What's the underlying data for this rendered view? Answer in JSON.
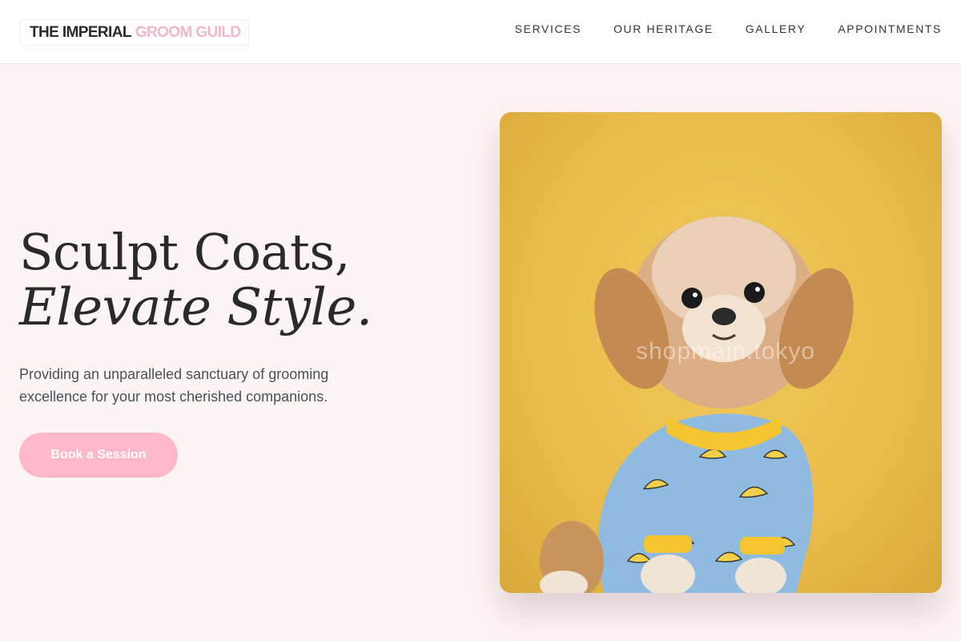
{
  "header": {
    "logo_dark": "THE IMPERIAL",
    "logo_pink": "GROOM GUILD",
    "nav": [
      "SERVICES",
      "OUR HERITAGE",
      "GALLERY",
      "APPOINTMENTS"
    ]
  },
  "hero": {
    "title_line1": "Sculpt Coats,",
    "title_line2": "Elevate Style.",
    "subtitle": "Providing an unparalleled sanctuary of grooming excellence for your most cherished companions.",
    "cta_label": "Book a Session"
  },
  "photo": {
    "image_name": "dog-in-banana-pajamas-photo",
    "watermark": "shopmain.tokyo"
  },
  "colors": {
    "accent_pink": "#ffb8c9",
    "logo_pink": "#f4b6c8",
    "background": "#fdf4f4",
    "photo_yellow": "#eabf4f"
  }
}
